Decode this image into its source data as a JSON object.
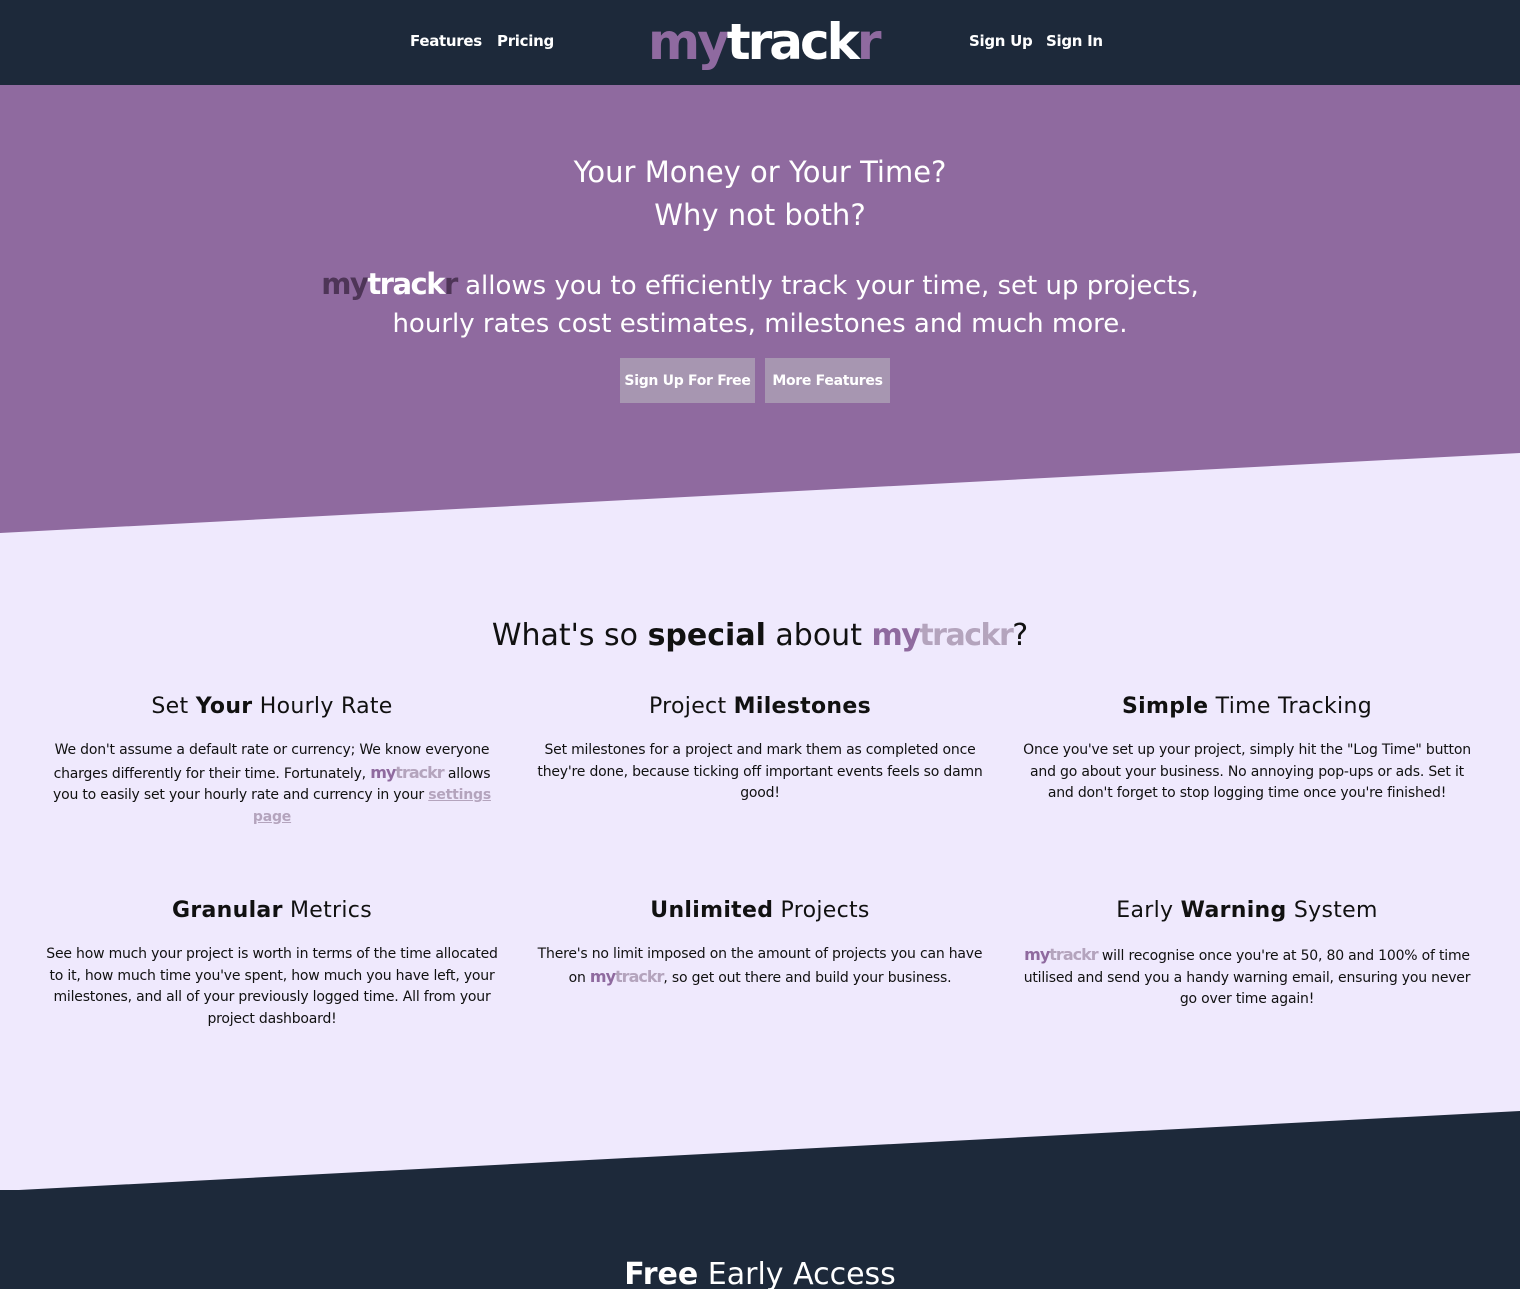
{
  "nav": {
    "features": "Features",
    "pricing": "Pricing",
    "brand_my": "my",
    "brand_track": "track",
    "brand_r": "r",
    "signup": "Sign Up",
    "signin": "Sign In"
  },
  "hero": {
    "title_line1": "Your Money or Your Time?",
    "title_line2": "Why not both?",
    "brand_my": "my",
    "brand_track": "track",
    "brand_r": "r",
    "sub_line1_rest": " allows you to efficiently track your time, set up projects,",
    "sub_line2": "hourly rates cost estimates, milestones and much more.",
    "btn_signup": "Sign Up For Free",
    "btn_features": "More Features"
  },
  "features": {
    "heading_pre": "What's so ",
    "heading_bold": "special",
    "heading_post": " about ",
    "heading_brand_my": "my",
    "heading_brand_track": "trackr",
    "heading_q": "?",
    "items": [
      {
        "title_a": "Set ",
        "title_b": "Your",
        "title_c": " Hourly Rate",
        "text_pre": "We don't assume a default rate or currency; We know everyone charges differently for their time. Fortunately, ",
        "brand_my": "my",
        "brand_track": "trackr",
        "text_post": " allows you to easily set your hourly rate and currency in your ",
        "link": "settings page"
      },
      {
        "title_a": "Project ",
        "title_b": "Milestones",
        "title_c": "",
        "text": "Set milestones for a project and mark them as completed once they're done, because ticking off important events feels so damn good!"
      },
      {
        "title_a": "",
        "title_b": "Simple",
        "title_c": " Time Tracking",
        "text": "Once you've set up your project, simply hit the \"Log Time\" button and go about your business. No annoying pop-ups or ads. Set it and don't forget to stop logging time once you're finished!"
      },
      {
        "title_a": "",
        "title_b": "Granular",
        "title_c": " Metrics",
        "text": "See how much your project is worth in terms of the time allocated to it, how much time you've spent, how much you have left, your milestones, and all of your previously logged time. All from your project dashboard!"
      },
      {
        "title_a": "",
        "title_b": "Unlimited",
        "title_c": " Projects",
        "text_pre": "There's no limit imposed on the amount of projects you can have on ",
        "brand_my": "my",
        "brand_track": "trackr",
        "text_post": ", so get out there and build your business."
      },
      {
        "title_a": "Early ",
        "title_b": "Warning",
        "title_c": " System",
        "brand_my": "my",
        "brand_track": "trackr",
        "text_post": " will recognise once you're at 50, 80 and 100% of time utilised and send you a handy warning email, ensuring you never go over time again!"
      }
    ]
  },
  "footer": {
    "title_bold": "Free",
    "title_rest": " Early Access"
  },
  "colors": {
    "nav_bg": "#1d293a",
    "hero_bg": "#8f6a9f",
    "page_bg": "#efe9fd",
    "button_bg": "#a796b1",
    "brand_light": "#b4a4bd"
  }
}
